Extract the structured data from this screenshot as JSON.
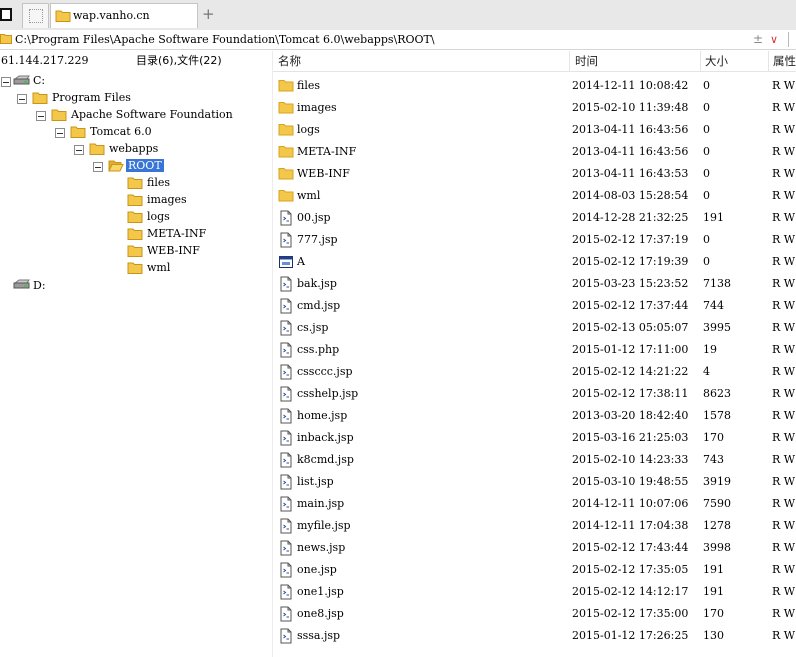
{
  "tab": {
    "title": "wap.vanho.cn",
    "new_tab": "+"
  },
  "address": {
    "path": "C:\\Program Files\\Apache Software Foundation\\Tomcat 6.0\\webapps\\ROOT\\"
  },
  "status": {
    "ip": "61.144.217.229",
    "summary": "目录(6),文件(22)"
  },
  "columns": {
    "name": "名称",
    "time": "时间",
    "size": "大小",
    "attr": "属性"
  },
  "tree": {
    "drive_c": "C:",
    "program_files": "Program Files",
    "apache": "Apache Software Foundation",
    "tomcat": "Tomcat 6.0",
    "webapps": "webapps",
    "root": "ROOT",
    "children": [
      "files",
      "images",
      "logs",
      "META-INF",
      "WEB-INF",
      "wml"
    ],
    "drive_d": "D:"
  },
  "files": [
    {
      "name": "files",
      "time": "2014-12-11 10:08:42",
      "size": "0",
      "attr": "R W",
      "icon": "folder"
    },
    {
      "name": "images",
      "time": "2015-02-10 11:39:48",
      "size": "0",
      "attr": "R W",
      "icon": "folder"
    },
    {
      "name": "logs",
      "time": "2013-04-11 16:43:56",
      "size": "0",
      "attr": "R W",
      "icon": "folder"
    },
    {
      "name": "META-INF",
      "time": "2013-04-11 16:43:56",
      "size": "0",
      "attr": "R W",
      "icon": "folder"
    },
    {
      "name": "WEB-INF",
      "time": "2013-04-11 16:43:53",
      "size": "0",
      "attr": "R W",
      "icon": "folder"
    },
    {
      "name": "wml",
      "time": "2014-08-03 15:28:54",
      "size": "0",
      "attr": "R W",
      "icon": "folder"
    },
    {
      "name": "00.jsp",
      "time": "2014-12-28 21:32:25",
      "size": "191",
      "attr": "R W",
      "icon": "file"
    },
    {
      "name": "777.jsp",
      "time": "2015-02-12 17:37:19",
      "size": "0",
      "attr": "R W",
      "icon": "file"
    },
    {
      "name": "A",
      "time": "2015-02-12 17:19:39",
      "size": "0",
      "attr": "R W",
      "icon": "app"
    },
    {
      "name": "bak.jsp",
      "time": "2015-03-23 15:23:52",
      "size": "7138",
      "attr": "R W",
      "icon": "file"
    },
    {
      "name": "cmd.jsp",
      "time": "2015-02-12 17:37:44",
      "size": "744",
      "attr": "R W",
      "icon": "file"
    },
    {
      "name": "cs.jsp",
      "time": "2015-02-13 05:05:07",
      "size": "3995",
      "attr": "R W",
      "icon": "file"
    },
    {
      "name": "css.php",
      "time": "2015-01-12 17:11:00",
      "size": "19",
      "attr": "R W",
      "icon": "file"
    },
    {
      "name": "cssccc.jsp",
      "time": "2015-02-12 14:21:22",
      "size": "4",
      "attr": "R W",
      "icon": "file"
    },
    {
      "name": "csshelp.jsp",
      "time": "2015-02-12 17:38:11",
      "size": "8623",
      "attr": "R W",
      "icon": "file"
    },
    {
      "name": "home.jsp",
      "time": "2013-03-20 18:42:40",
      "size": "1578",
      "attr": "R W",
      "icon": "file"
    },
    {
      "name": "inback.jsp",
      "time": "2015-03-16 21:25:03",
      "size": "170",
      "attr": "R W",
      "icon": "file"
    },
    {
      "name": "k8cmd.jsp",
      "time": "2015-02-10 14:23:33",
      "size": "743",
      "attr": "R W",
      "icon": "file"
    },
    {
      "name": "list.jsp",
      "time": "2015-03-10 19:48:55",
      "size": "3919",
      "attr": "R W",
      "icon": "file"
    },
    {
      "name": "main.jsp",
      "time": "2014-12-11 10:07:06",
      "size": "7590",
      "attr": "R W",
      "icon": "file"
    },
    {
      "name": "myfile.jsp",
      "time": "2014-12-11 17:04:38",
      "size": "1278",
      "attr": "R W",
      "icon": "file"
    },
    {
      "name": "news.jsp",
      "time": "2015-02-12 17:43:44",
      "size": "3998",
      "attr": "R W",
      "icon": "file"
    },
    {
      "name": "one.jsp",
      "time": "2015-02-12 17:35:05",
      "size": "191",
      "attr": "R W",
      "icon": "file"
    },
    {
      "name": "one1.jsp",
      "time": "2015-02-12 14:12:17",
      "size": "191",
      "attr": "R W",
      "icon": "file"
    },
    {
      "name": "one8.jsp",
      "time": "2015-02-12 17:35:00",
      "size": "170",
      "attr": "R W",
      "icon": "file"
    },
    {
      "name": "sssa.jsp",
      "time": "2015-01-12 17:26:25",
      "size": "130",
      "attr": "R W",
      "icon": "file"
    }
  ],
  "colors": {
    "folder": "#f3c84a",
    "folder_dark": "#d9a21f",
    "selection": "#3875d7"
  }
}
